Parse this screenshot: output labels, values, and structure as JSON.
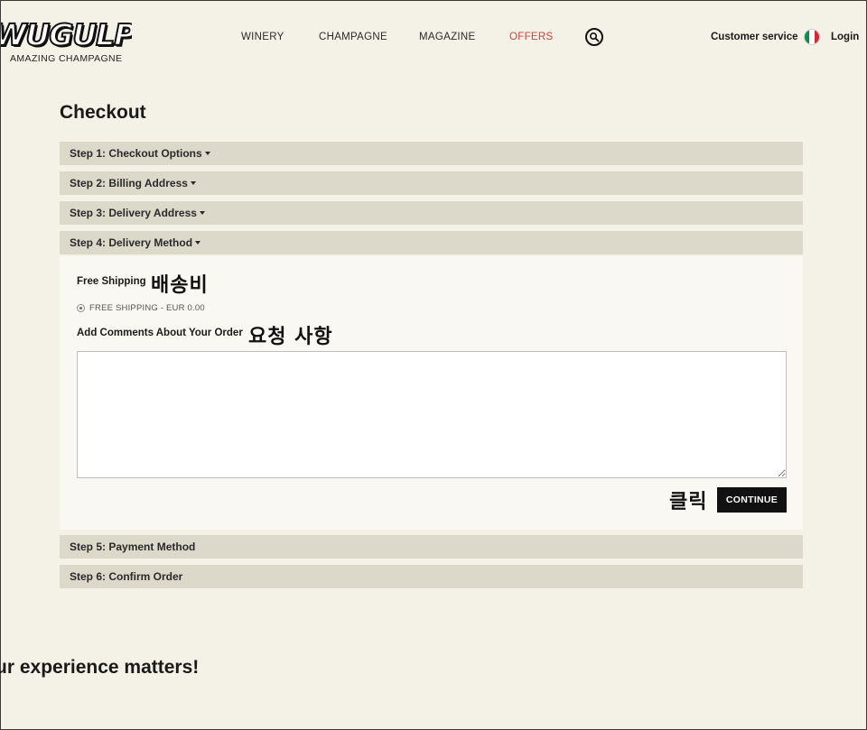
{
  "brand": {
    "logo_word": "WUGULP!",
    "tagline": "AMAZING CHAMPAGNE"
  },
  "nav": [
    {
      "label": "WINERY"
    },
    {
      "label": "CHAMPAGNE"
    },
    {
      "label": "MAGAZINE"
    },
    {
      "label": "OFFERS"
    }
  ],
  "header": {
    "customer_service": "Customer service",
    "login": "Login",
    "flag_colors": [
      "#009246",
      "#ffffff",
      "#ce2b37"
    ],
    "search_icon": "search-icon"
  },
  "page": {
    "title": "Checkout"
  },
  "steps": [
    {
      "label": "Step 1: Checkout Options"
    },
    {
      "label": "Step 2: Billing Address"
    },
    {
      "label": "Step 3: Delivery Address"
    },
    {
      "label": "Step 4: Delivery Method"
    },
    {
      "label": "Step 5: Payment Method"
    },
    {
      "label": "Step 6: Confirm Order"
    }
  ],
  "delivery": {
    "shipping_heading": "Free Shipping",
    "shipping_annotation": "배송비",
    "option_label": "FREE SHIPPING - EUR 0.00",
    "comments_label": "Add Comments About Your Order",
    "comments_annotation": "요청 사항",
    "comments_value": "",
    "click_annotation": "클릭",
    "continue_label": "CONTINUE"
  },
  "footer": {
    "heading": "ur experience matters!"
  },
  "colors": {
    "background": "#f4f1e6",
    "step_bar": "#dcd9cb",
    "panel": "#f9f8f2",
    "offers_accent": "#c8453c",
    "button": "#111111"
  }
}
